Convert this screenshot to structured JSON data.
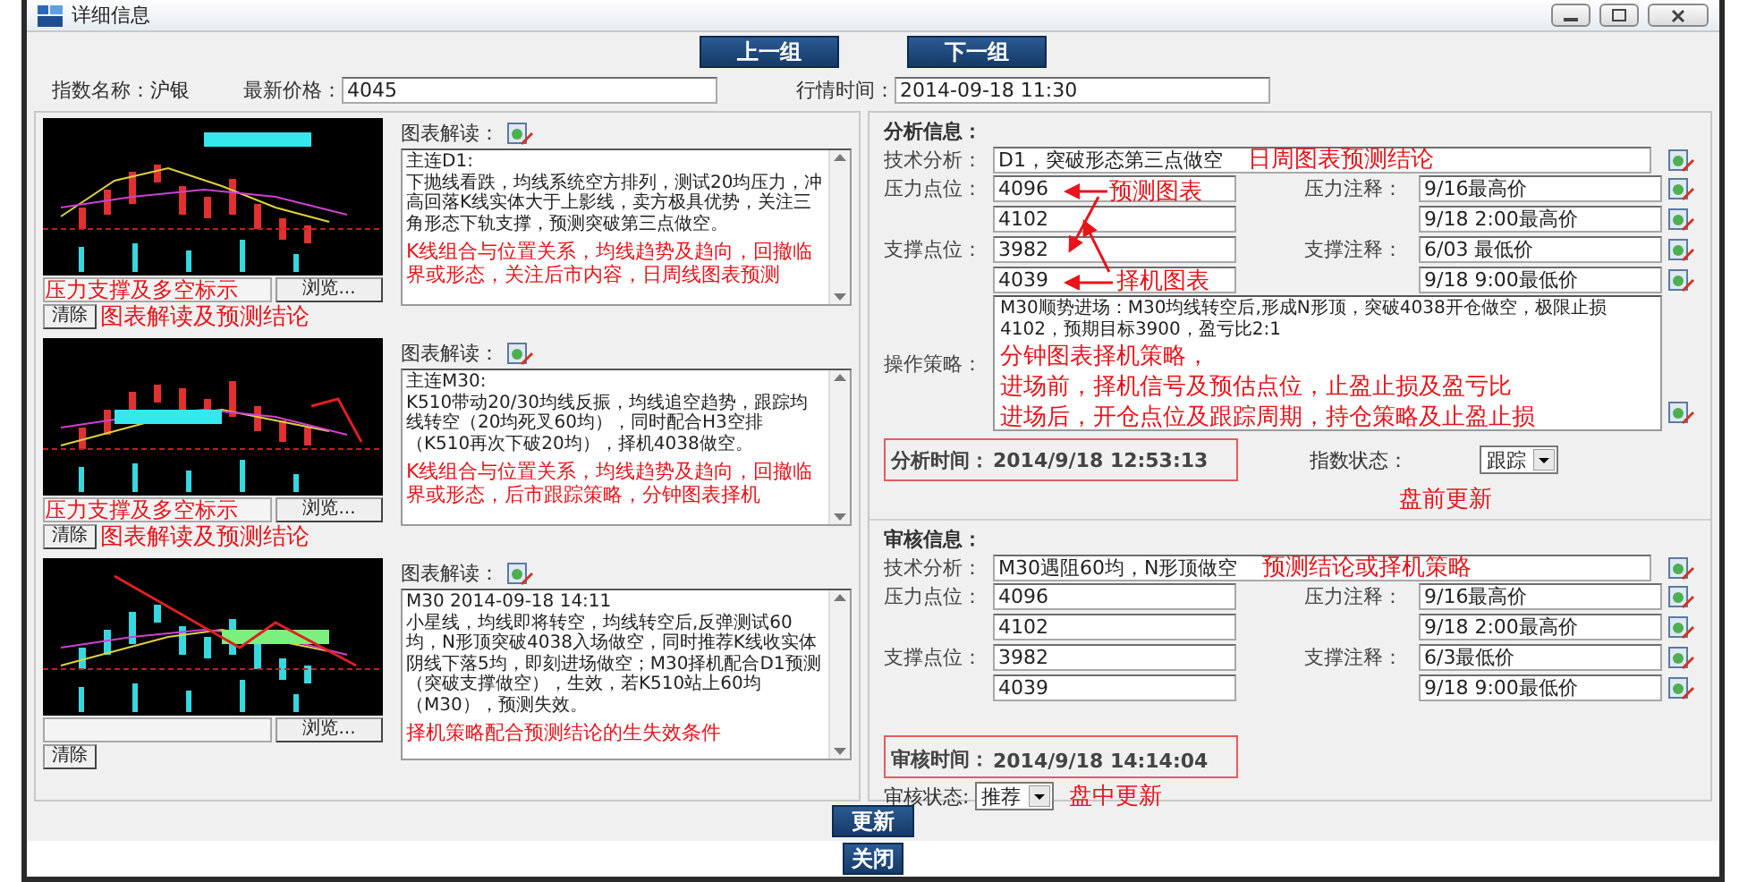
{
  "window": {
    "title": "详细信息"
  },
  "nav_buttons": [
    "上一组",
    "下一组"
  ],
  "info": {
    "name_label": "指数名称：",
    "name": "沪银",
    "price_label": "最新价格：",
    "price": "4045",
    "time_label": "行情时间：",
    "time": "2014-09-18 11:30"
  },
  "chart_blocks": [
    {
      "file_note": "压力支撑及多空标示",
      "browse": "浏览...",
      "clear": "清除",
      "clear_note": "图表解读及预测结论",
      "label": "图表解读：",
      "lines": [
        "主连D1:",
        "下抛线看跌，均线系统空方排列，测试20均压力，冲高回落K线实体大于上影线，卖方极具优势，关注三角形态下轨支撑，预测突破第三点做空。"
      ],
      "note": "K线组合与位置关系，均线趋势及趋向，回撤临界或形态，关注后市内容，日周线图表预测"
    },
    {
      "file_note": "压力支撑及多空标示",
      "browse": "浏览...",
      "clear": "清除",
      "clear_note": "图表解读及预测结论",
      "label": "图表解读：",
      "lines": [
        "主连M30:",
        "K510带动20/30均线反振，均线追空趋势，跟踪均线转空（20均死叉60均），同时配合H3空排（K510再次下破20均），择机4038做空。"
      ],
      "note": "K线组合与位置关系，均线趋势及趋向，回撤临界或形态，后市跟踪策略，分钟图表择机"
    },
    {
      "browse": "浏览...",
      "clear": "清除",
      "label": "图表解读：",
      "lines": [
        "M30 2014-09-18 14:11",
        "小星线，均线即将转空，均线转空后,反弹测试60均，N形顶突破4038入场做空，同时推荐K线收实体阴线下落5均，即刻进场做空；M30择机配合D1预测（突破支撑做空），生效，若K510站上60均（M30），预测失效。"
      ],
      "note": "择机策略配合预测结论的生失效条件"
    }
  ],
  "analysis": {
    "title": "分析信息：",
    "tech_label": "技术分析：",
    "tech": "D1，突破形态第三点做空",
    "tech_note": "日周图表预测结论",
    "rows": [
      {
        "label": "压力点位：",
        "value": "4096",
        "comment_label": "压力注释：",
        "comment": "9/16最高价"
      },
      {
        "value": "4102",
        "comment": "9/18 2:00最高价"
      },
      {
        "label": "支撑点位：",
        "value": "3982",
        "comment_label": "支撑注释：",
        "comment": "6/03 最低价"
      },
      {
        "value": "4039",
        "comment": "9/18 9:00最低价"
      }
    ],
    "arrow_notes": [
      "预测图表",
      "择机图表"
    ],
    "strategy_label": "操作策略：",
    "strategy": "M30顺势进场：M30均线转空后,形成N形顶，突破4038开仓做空，极限止损4102，预期目标3900，盈亏比2:1",
    "strategy_notes": [
      "分钟图表择机策略，",
      "进场前，择机信号及预估点位，止盈止损及盈亏比",
      "进场后，开仓点位及跟踪周期，持仓策略及止盈止损"
    ],
    "time_label": "分析时间：",
    "time": "2014/9/18 12:53:13",
    "status_label": "指数状态：",
    "status": "跟踪",
    "status_note": "盘前更新"
  },
  "review": {
    "title": "审核信息：",
    "tech_label": "技术分析：",
    "tech": "M30遇阻60均，N形顶做空",
    "tech_note": "预测结论或择机策略",
    "rows": [
      {
        "label": "压力点位：",
        "value": "4096",
        "comment_label": "压力注释：",
        "comment": "9/16最高价"
      },
      {
        "value": "4102",
        "comment": "9/18 2:00最高价"
      },
      {
        "label": "支撑点位：",
        "value": "3982",
        "comment_label": "支撑注释：",
        "comment": "6/3最低价"
      },
      {
        "value": "4039",
        "comment": "9/18 9:00最低价"
      }
    ],
    "time_label": "审核时间：",
    "time": "2014/9/18 14:14:04",
    "status_label": "审核状态:",
    "status": "推荐",
    "status_note": "盘中更新"
  },
  "update_button": "更新",
  "close_button": "关闭"
}
